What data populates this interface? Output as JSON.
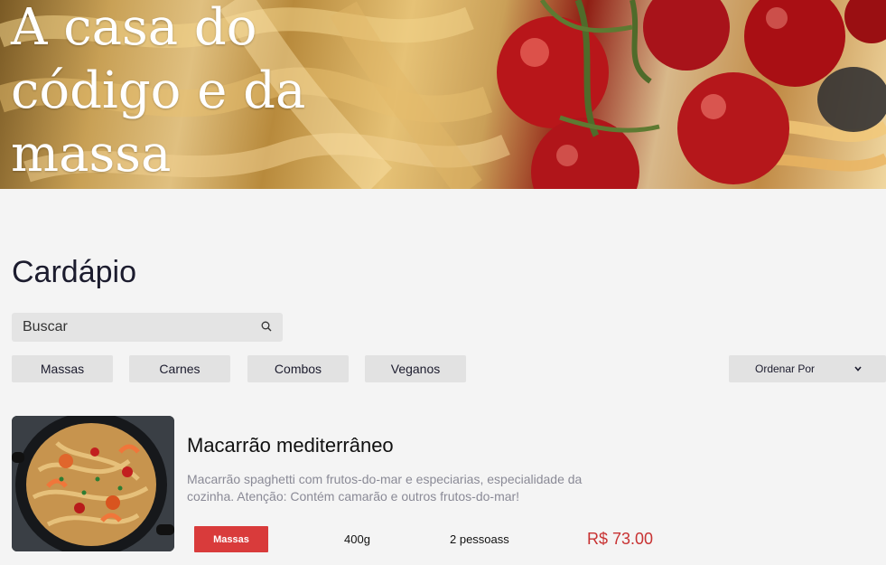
{
  "hero": {
    "title": "A casa do código e da massa"
  },
  "menu": {
    "title": "Cardápio",
    "search": {
      "placeholder": "Buscar",
      "icon": "search-icon"
    },
    "categories": [
      "Massas",
      "Carnes",
      "Combos",
      "Veganos"
    ],
    "sort": {
      "label": "Ordenar Por",
      "icon": "chevron-down-icon"
    }
  },
  "items": [
    {
      "name": "Macarrão mediterrâneo",
      "description": "Macarrão spaghetti com frutos-do-mar e especiarias, especialidade da cozinha. Atenção: Contém camarão e outros frutos-do-mar!",
      "category": "Massas",
      "size": "400g",
      "serves": "2 pessoass",
      "price": "R$ 73.00"
    }
  ],
  "colors": {
    "background": "#f4f4f4",
    "chip": "#e2e2e2",
    "tag": "#d93b3b",
    "price": "#c83232",
    "title": "#1c1c2e"
  }
}
